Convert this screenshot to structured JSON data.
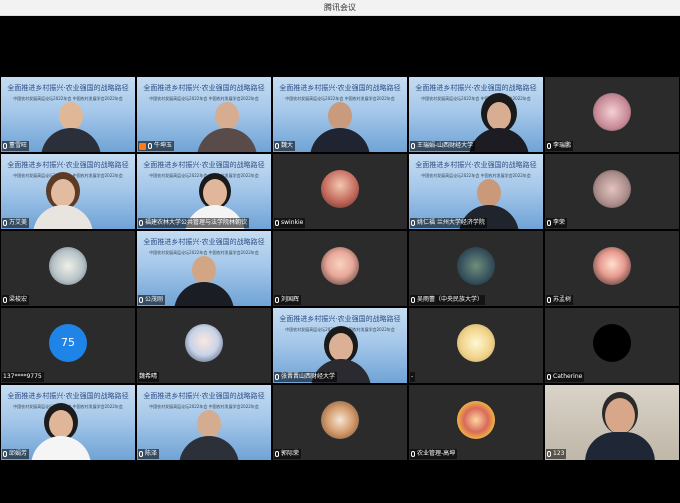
{
  "window": {
    "title": "腾讯会议"
  },
  "banner": {
    "calligraphy": "全面推进乡村振兴·农业强国的战略路径",
    "subtitle": "中国农村发展高层论坛2022年会 中国农村发展学会2022年会",
    "subtitle2": "主办单位：中国农村发展学会"
  },
  "participants": [
    {
      "name": "董雪旺",
      "kind": "video-blue"
    },
    {
      "name": "牛坤玉",
      "kind": "video-blue",
      "host": true
    },
    {
      "name": "魏大",
      "kind": "video-blue"
    },
    {
      "name": "王瑞娟-山西财经大学",
      "kind": "video-blue"
    },
    {
      "name": "李瑞鹏",
      "kind": "avatar"
    },
    {
      "name": "万艾美",
      "kind": "video-blue"
    },
    {
      "name": "福建农林大学公共管理与法学院林朝钦",
      "kind": "video-blue"
    },
    {
      "name": "swinkie",
      "kind": "avatar"
    },
    {
      "name": "姚仁福 兰州大学经济学院",
      "kind": "video-blue"
    },
    {
      "name": "李荣",
      "kind": "avatar"
    },
    {
      "name": "梁梭宏",
      "kind": "avatar"
    },
    {
      "name": "公茂刚",
      "kind": "video-blue"
    },
    {
      "name": "刘国辉",
      "kind": "avatar"
    },
    {
      "name": "吴雨蕾（中央民族大学）",
      "kind": "avatar"
    },
    {
      "name": "苏孟树",
      "kind": "avatar"
    },
    {
      "name": "137****9775",
      "kind": "number",
      "badge": "75"
    },
    {
      "name": "魏希晴",
      "kind": "avatar"
    },
    {
      "name": "张晋晋山西财经大学",
      "kind": "video-blue"
    },
    {
      "name": "-",
      "kind": "avatar"
    },
    {
      "name": "Catherine",
      "kind": "avatar"
    },
    {
      "name": "邱娟芳",
      "kind": "video-blue"
    },
    {
      "name": "陈泽",
      "kind": "video-blue"
    },
    {
      "name": "郭际荣",
      "kind": "avatar"
    },
    {
      "name": "农业管理-高坤",
      "kind": "avatar"
    },
    {
      "name": "123",
      "kind": "video-room"
    }
  ]
}
